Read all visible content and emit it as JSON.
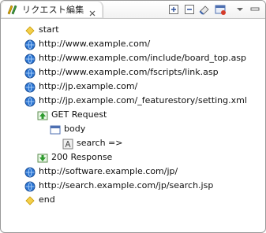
{
  "header": {
    "tab_title": "リクエスト編集"
  },
  "tree": {
    "items": [
      {
        "label": "start"
      },
      {
        "label": "http://www.example.com/"
      },
      {
        "label": "http://www.example.com/include/board_top.asp"
      },
      {
        "label": "http://www.example.com/fscripts/link.asp"
      },
      {
        "label": "http://jp.example.com/"
      },
      {
        "label": "http://jp.example.com/_featurestory/setting.xml"
      },
      {
        "label": "GET   Request"
      },
      {
        "label": "body"
      },
      {
        "label": "search =>"
      },
      {
        "label": "200   Response"
      },
      {
        "label": "http://software.example.com/jp/"
      },
      {
        "label": "http://search.example.com/jp/search.jsp"
      },
      {
        "label": "end"
      }
    ]
  },
  "icons": {
    "tab": "request-edit-icon",
    "close": "close-icon",
    "toolbar": [
      "expand-all-icon",
      "collapse-all-icon",
      "clear-icon",
      "edit-icon",
      "view-menu-icon"
    ],
    "tree": [
      "diamond-icon",
      "globe-icon",
      "request-icon",
      "body-icon",
      "variable-icon",
      "response-icon"
    ]
  }
}
